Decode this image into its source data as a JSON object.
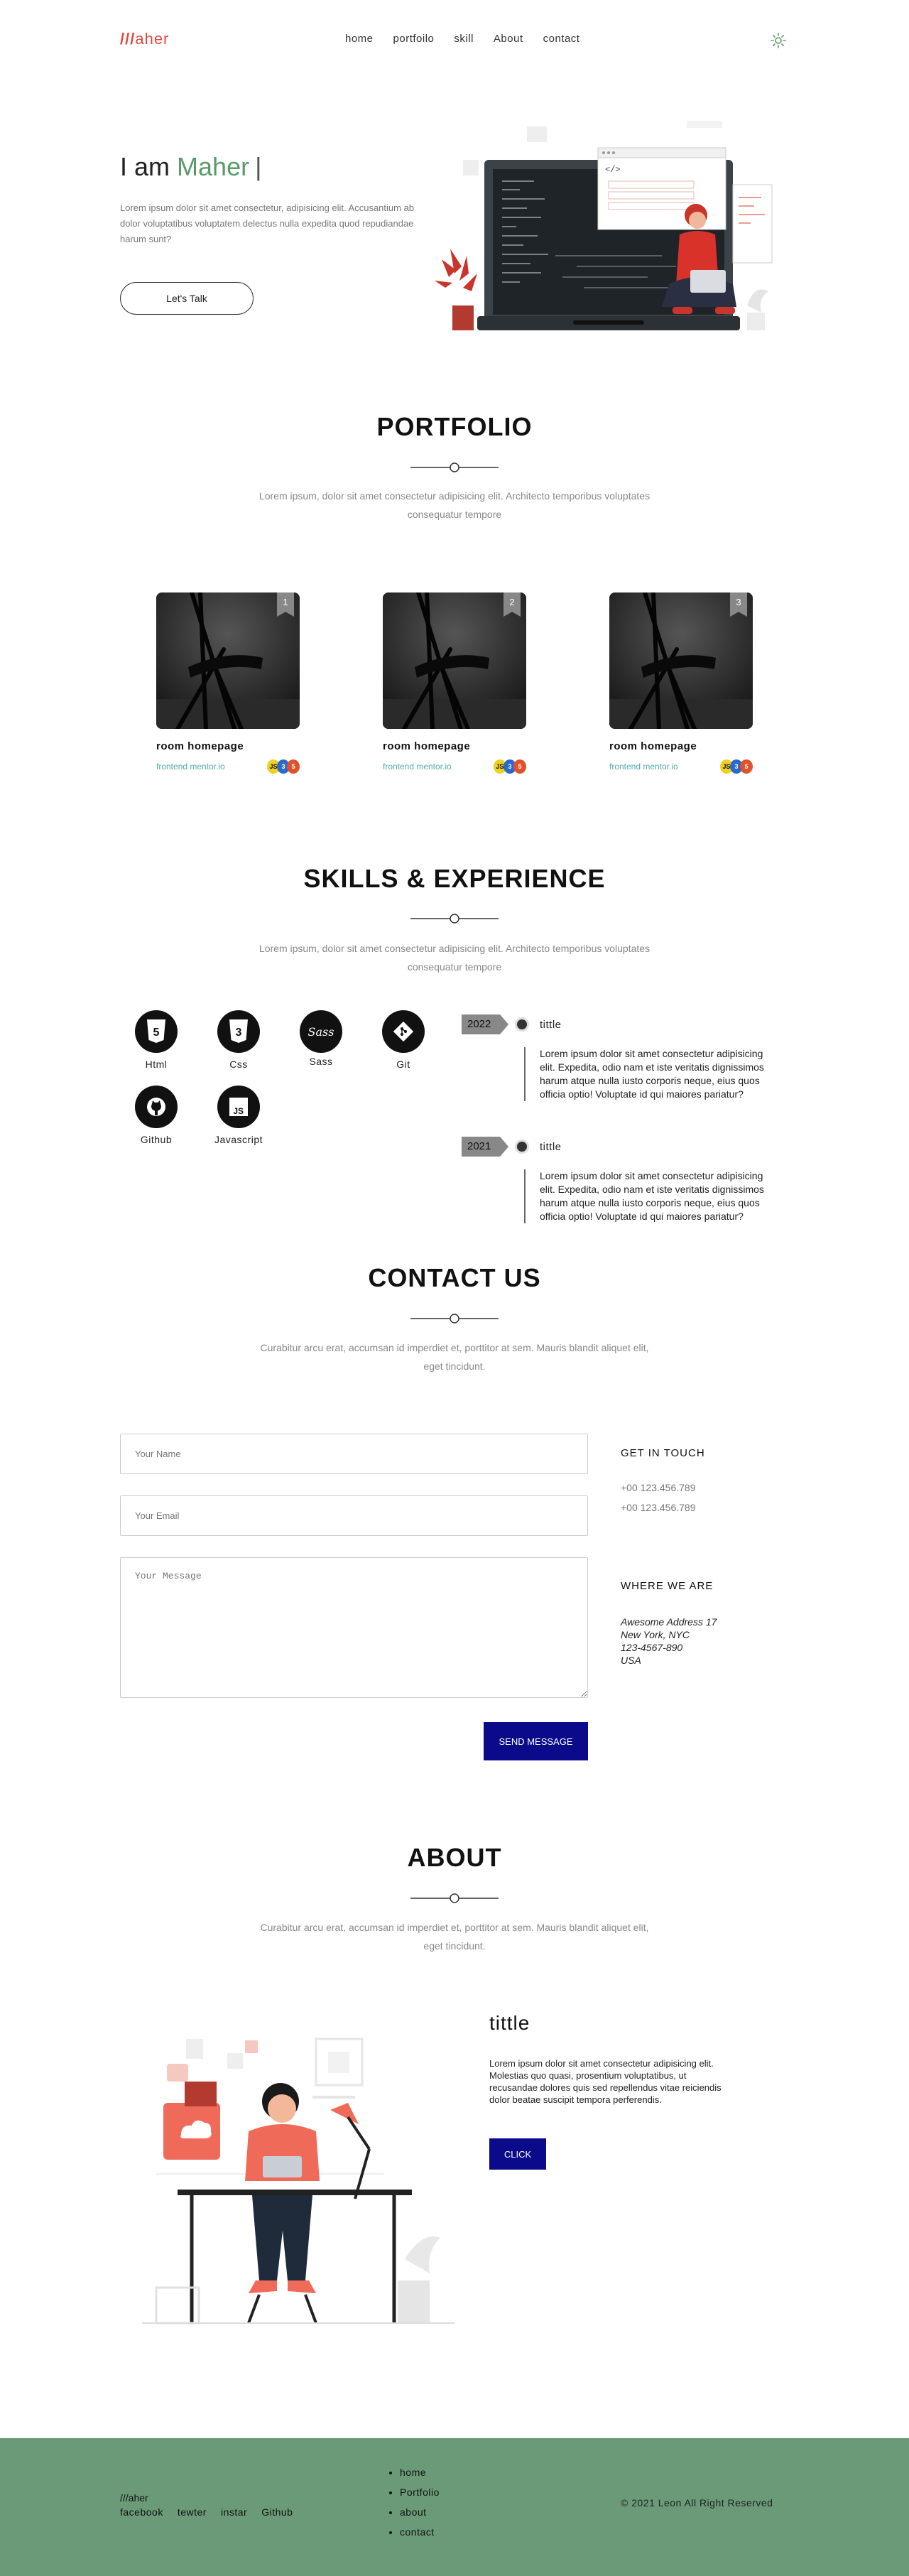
{
  "nav": {
    "logo_slashes": "///",
    "logo_text": "aher",
    "links": [
      "home",
      "portfoilo",
      "skill",
      "About",
      "contact"
    ]
  },
  "hero": {
    "greeting": "I am",
    "name": "Maher",
    "caret": "|",
    "text": "Lorem ipsum dolor sit amet consectetur, adipisicing elit. Accusantium ab dolor voluptatibus voluptatem delectus nulla expedita quod repudiandae harum sunt?",
    "button": "Let's Talk",
    "code_tag": "</>"
  },
  "portfolio": {
    "title": "PORTFOLIO",
    "subtitle": "Lorem ipsum, dolor sit amet consectetur adipisicing elit. Architecto temporibus voluptates consequatur tempore",
    "cards": [
      {
        "num": "1",
        "title": "room homepage",
        "site": "frontend mentor.io"
      },
      {
        "num": "2",
        "title": "room homepage",
        "site": "frontend mentor.io"
      },
      {
        "num": "3",
        "title": "room homepage",
        "site": "frontend mentor.io"
      }
    ]
  },
  "skills": {
    "title": "SKILLS & EXPERIENCE",
    "subtitle": "Lorem ipsum, dolor sit amet consectetur adipisicing elit. Architecto temporibus voluptates consequatur tempore",
    "items": [
      "Html",
      "Css",
      "Sass",
      "Git",
      "Github",
      "Javascript"
    ],
    "experience": [
      {
        "year": "2022",
        "title": "tittle",
        "text": "Lorem ipsum dolor sit amet consectetur adipisicing elit. Expedita, odio nam et iste veritatis dignissimos harum atque nulla iusto corporis neque, eius quos officia optio! Voluptate id qui maiores pariatur?"
      },
      {
        "year": "2021",
        "title": "tittle",
        "text": "Lorem ipsum dolor sit amet consectetur adipisicing elit. Expedita, odio nam et iste veritatis dignissimos harum atque nulla iusto corporis neque, eius quos officia optio! Voluptate id qui maiores pariatur?"
      }
    ]
  },
  "contact": {
    "title": "CONTACT US",
    "subtitle": "Curabitur arcu erat, accumsan id imperdiet et, porttitor at sem. Mauris blandit aliquet elit, eget tincidunt.",
    "name_placeholder": "Your Name",
    "email_placeholder": "Your Email",
    "message_placeholder": "Your Message",
    "send": "SEND MESSAGE",
    "get_in_touch": "GET IN TOUCH",
    "phone1": "+00 123.456.789",
    "phone2": "+00 123.456.789",
    "where": "WHERE WE ARE",
    "address1": "Awesome Address 17",
    "address2": "New York, NYC",
    "address3": "123-4567-890",
    "address4": "USA"
  },
  "about": {
    "title": "ABOUT",
    "subtitle": "Curabitur arcu erat, accumsan id imperdiet et, porttitor at sem. Mauris blandit aliquet elit, eget tincidunt.",
    "heading": "tittle",
    "text": "Lorem ipsum dolor sit amet consectetur adipisicing elit. Molestias quo quasi, prosentium voluptatibus, ut recusandae dolores quis sed repellendus vitae reiciendis dolor beatae suscipit tempora perferendis.",
    "button": "CLICK"
  },
  "footer": {
    "logo": "///aher",
    "social": [
      "facebook",
      "tewter",
      "instar",
      "Github"
    ],
    "links": [
      "home",
      "Portfolio",
      "about",
      "contact"
    ],
    "copyright": "© 2021 Leon All Right Reserved"
  },
  "colors": {
    "accent_red": "#e04a3a",
    "accent_green": "#5a9a6a",
    "footer_bg": "#6a9a78",
    "button_blue": "#0a0a8a"
  }
}
